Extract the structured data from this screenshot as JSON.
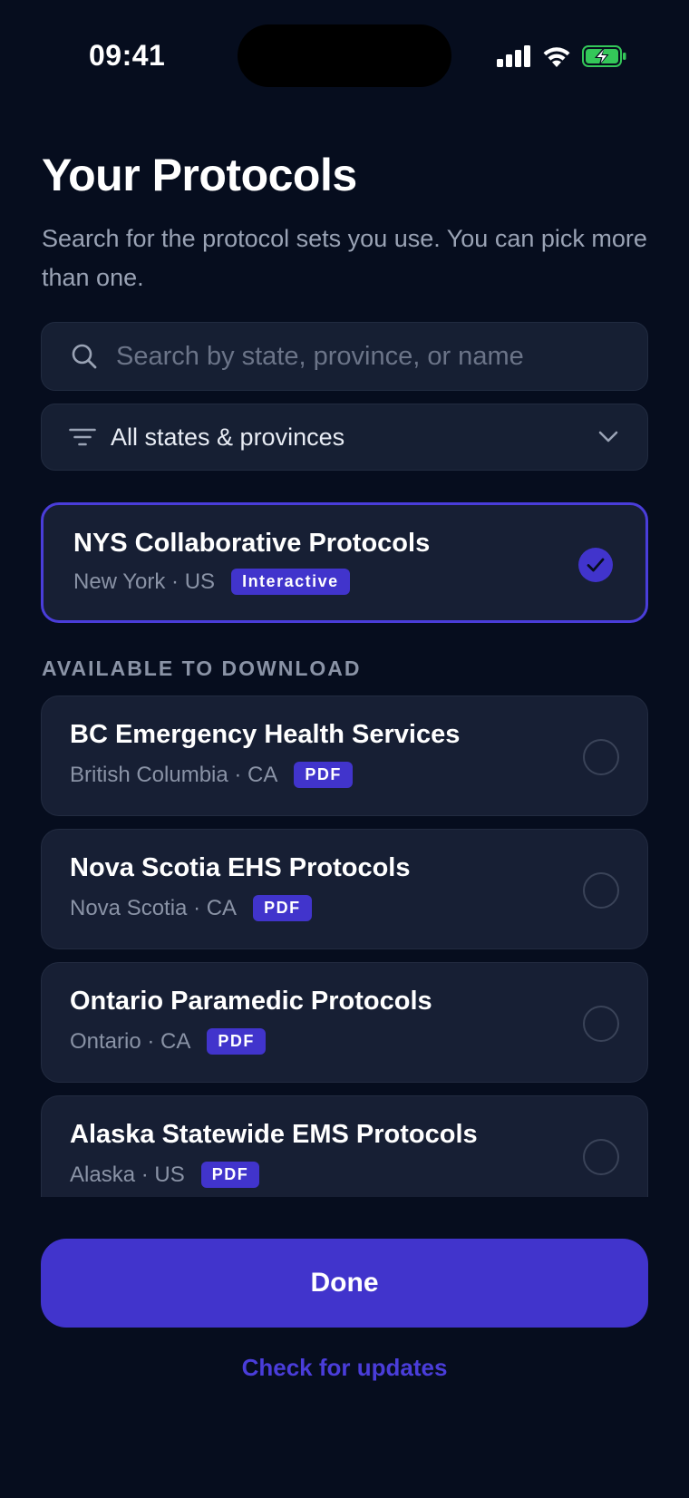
{
  "status_bar": {
    "time": "09:41"
  },
  "header": {
    "title": "Your Protocols",
    "subtitle": "Search for the protocol sets you use. You can pick more than one."
  },
  "search": {
    "placeholder": "Search by state, province, or name",
    "icon": "search-icon"
  },
  "filter": {
    "label": "All states & provinces",
    "icon": "filter-icon",
    "chevron": "chevron-down-icon"
  },
  "selected_protocols": [
    {
      "title": "NYS Collaborative Protocols",
      "location": "New York · US",
      "badge": "Interactive",
      "selected": true
    }
  ],
  "available_section": {
    "heading": "AVAILABLE TO DOWNLOAD"
  },
  "available_protocols": [
    {
      "title": "BC Emergency Health Services",
      "location": "British Columbia · CA",
      "badge": "PDF",
      "selected": false
    },
    {
      "title": "Nova Scotia EHS Protocols",
      "location": "Nova Scotia · CA",
      "badge": "PDF",
      "selected": false
    },
    {
      "title": "Ontario Paramedic Protocols",
      "location": "Ontario · CA",
      "badge": "PDF",
      "selected": false
    },
    {
      "title": "Alaska Statewide EMS Protocols",
      "location": "Alaska · US",
      "badge": "PDF",
      "selected": false
    }
  ],
  "footer": {
    "done_label": "Done",
    "updates_label": "Check for updates"
  },
  "colors": {
    "background": "#060D1E",
    "card": "#171F34",
    "accent": "#4134CC",
    "battery": "#34C759"
  }
}
